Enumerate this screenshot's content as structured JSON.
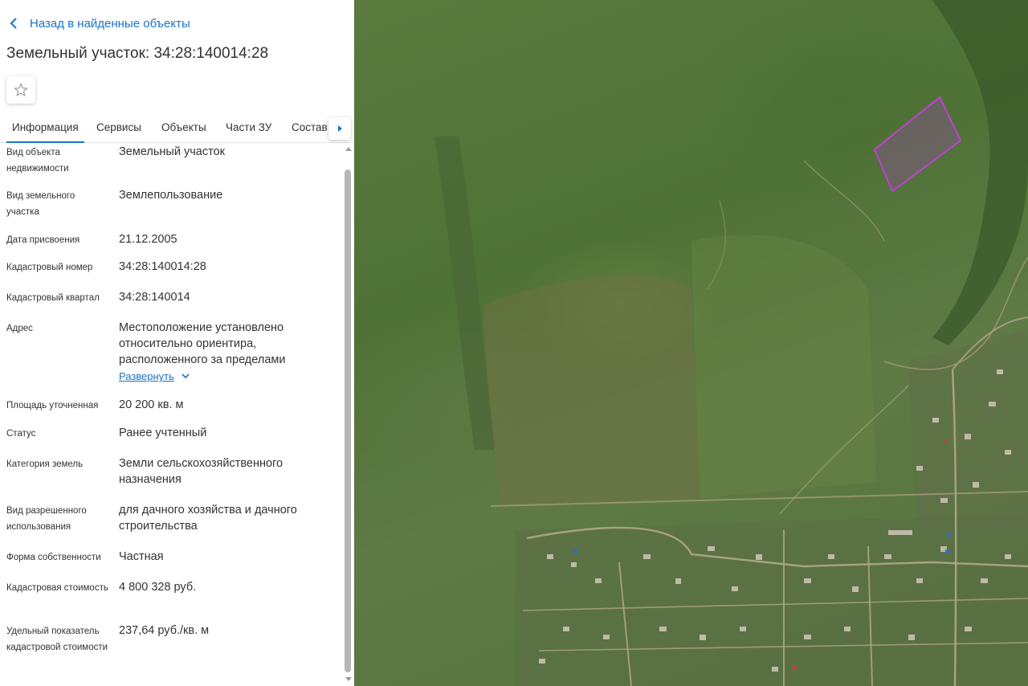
{
  "header": {
    "back_label": "Назад в найденные объекты",
    "title": "Земельный участок: 34:28:140014:28"
  },
  "icons": {
    "back": "chevron-left-icon",
    "favorite": "star-outline-icon",
    "tabs_next": "caret-right-icon",
    "expand": "chevron-down-icon"
  },
  "tabs": [
    {
      "label": "Информация",
      "active": true
    },
    {
      "label": "Сервисы",
      "active": false
    },
    {
      "label": "Объекты",
      "active": false
    },
    {
      "label": "Части ЗУ",
      "active": false
    },
    {
      "label": "Состав",
      "active": false
    }
  ],
  "properties": [
    {
      "label": "Вид объекта недвижимости",
      "value": "Земельный участок"
    },
    {
      "label": "Вид земельного участка",
      "value": "Землепользование"
    },
    {
      "label": "Дата присвоения",
      "value": "21.12.2005"
    },
    {
      "label": "Кадастровый номер",
      "value": "34:28:140014:28"
    },
    {
      "label": "Кадастровый квартал",
      "value": "34:28:140014"
    },
    {
      "label": "Адрес",
      "value": "Местоположение установлено относительно ориентира, расположенного за пределами",
      "expand_label": "Развернуть"
    },
    {
      "label": "Площадь уточненная",
      "value": "20 200 кв. м"
    },
    {
      "label": "Статус",
      "value": "Ранее учтенный"
    },
    {
      "label": "Категория земель",
      "value": "Земли сельскохозяйственного назначения"
    },
    {
      "label": "Вид разрешенного использования",
      "value": "для дачного хозяйства и дачного строительства"
    },
    {
      "label": "Форма собственности",
      "value": "Частная"
    },
    {
      "label": "Кадастровая стоимость",
      "value": "4 800 328 руб."
    },
    {
      "label": "Удельный показатель кадастровой стоимости",
      "value": "237,64 руб./кв. м"
    }
  ],
  "colors": {
    "accent": "#1a73c8",
    "text": "#333333",
    "parcel_outline": "#c23fd6"
  }
}
